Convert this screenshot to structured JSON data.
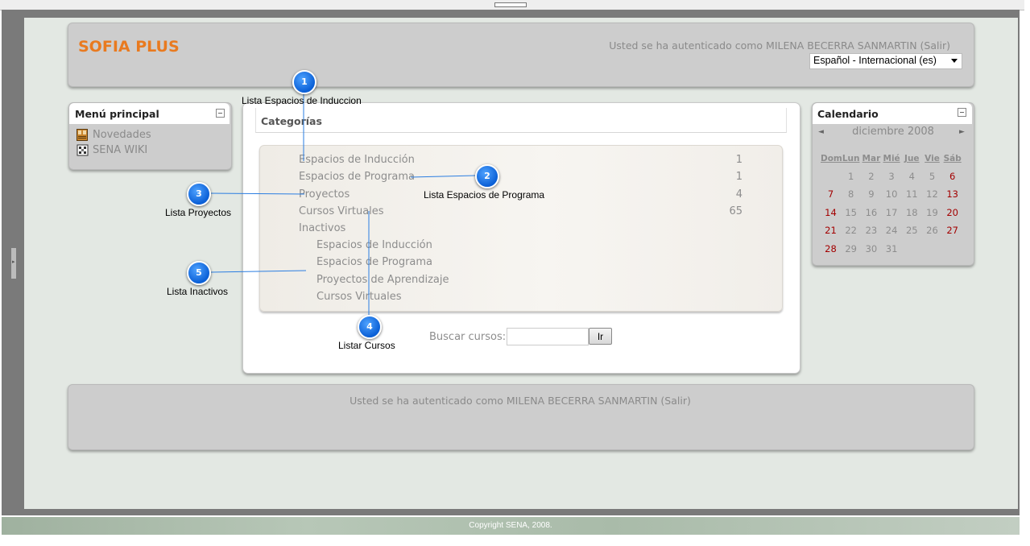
{
  "header": {
    "logo": "SOFIA PLUS",
    "login_info": "Usted se ha autenticado como MILENA BECERRA SANMARTIN (Salir)",
    "language": "Español - Internacional (es)"
  },
  "menu": {
    "title": "Menú principal",
    "items": [
      {
        "label": "Novedades",
        "icon": "news-icon"
      },
      {
        "label": "SENA WIKI",
        "icon": "wiki-icon"
      }
    ]
  },
  "categories": {
    "title": "Categorías",
    "items": [
      {
        "label": "Espacios de Inducción",
        "count": "1"
      },
      {
        "label": "Espacios de Programa",
        "count": "1"
      },
      {
        "label": "Proyectos",
        "count": "4"
      },
      {
        "label": "Cursos Virtuales",
        "count": "65"
      },
      {
        "label": "Inactivos",
        "count": ""
      }
    ],
    "inactive_sub": [
      "Espacios de Inducción",
      "Espacios de Programa",
      "Proyectos de Aprendizaje",
      "Cursos Virtuales"
    ]
  },
  "search": {
    "label": "Buscar cursos:",
    "value": "",
    "button": "Ir"
  },
  "calendar": {
    "title": "Calendario",
    "month": "diciembre 2008",
    "prev": "◄",
    "next": "►",
    "weekdays": [
      "Dom",
      "Lun",
      "Mar",
      "Mié",
      "Jue",
      "Vie",
      "Sáb"
    ],
    "weeks": [
      [
        "",
        "1",
        "2",
        "3",
        "4",
        "5",
        "6"
      ],
      [
        "7",
        "8",
        "9",
        "10",
        "11",
        "12",
        "13"
      ],
      [
        "14",
        "15",
        "16",
        "17",
        "18",
        "19",
        "20"
      ],
      [
        "21",
        "22",
        "23",
        "24",
        "25",
        "26",
        "27"
      ],
      [
        "28",
        "29",
        "30",
        "31",
        "",
        "",
        ""
      ]
    ],
    "weekend_color": "#a30000"
  },
  "footer": {
    "login_info": "Usted se ha autenticado como MILENA BECERRA SANMARTIN (Salir)",
    "copyright": "Copyright SENA, 2008."
  },
  "callouts": [
    {
      "num": "1",
      "label": "Lista Espacios de Induccion"
    },
    {
      "num": "2",
      "label": "Lista Espacios de Programa"
    },
    {
      "num": "3",
      "label": "Lista Proyectos"
    },
    {
      "num": "4",
      "label": "Listar Cursos"
    },
    {
      "num": "5",
      "label": "Lista Inactivos"
    }
  ],
  "colors": {
    "brand": "#e97a1f",
    "callout": "#0a5fd6",
    "muted_text": "#8d8d8d"
  }
}
